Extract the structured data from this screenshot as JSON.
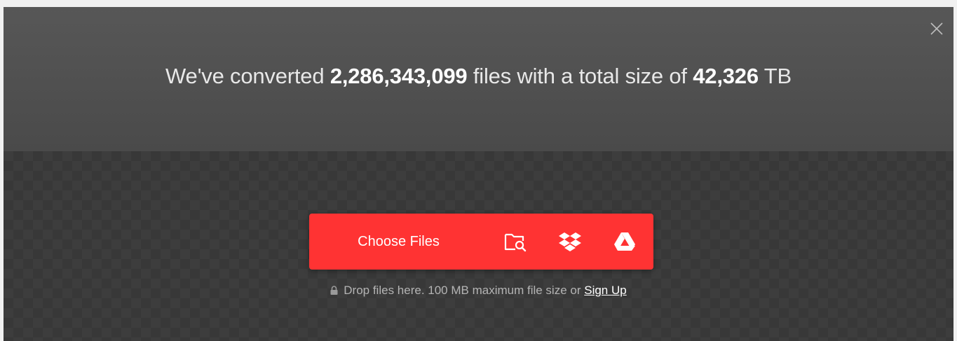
{
  "stats": {
    "prefix": "We've converted",
    "files_count": "2,286,343,099",
    "middle": "files with a total size of",
    "total_size": "42,326",
    "unit": "TB"
  },
  "upload": {
    "choose_label": "Choose Files",
    "sources": [
      {
        "icon": "folder-search-icon"
      },
      {
        "icon": "dropbox-icon"
      },
      {
        "icon": "google-drive-icon"
      }
    ]
  },
  "hint": {
    "text": "Drop files here. 100 MB maximum file size or",
    "link": "Sign Up"
  },
  "colors": {
    "accent": "#ff3333",
    "hero_bg": "#555555",
    "dropzone_bg": "#3d3d3d"
  }
}
